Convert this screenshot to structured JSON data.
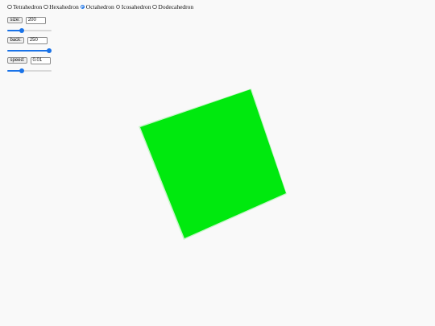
{
  "shapes": {
    "options": [
      "Tetrahedron",
      "Hexahedron",
      "Octahedron",
      "Icosahedron",
      "Dodecahedron"
    ],
    "selected": "Octahedron"
  },
  "controls": {
    "size": {
      "button_label": "size:",
      "value": "200",
      "slider_fraction": 0.33
    },
    "back": {
      "button_label": "back:",
      "value": "250",
      "slider_fraction": 1.0
    },
    "speed": {
      "button_label": "speed:",
      "value": "0.01",
      "slider_fraction": 0.33
    }
  },
  "scene": {
    "face_color": "#00e90e",
    "edge_highlight_color": "#c7f5c9"
  }
}
